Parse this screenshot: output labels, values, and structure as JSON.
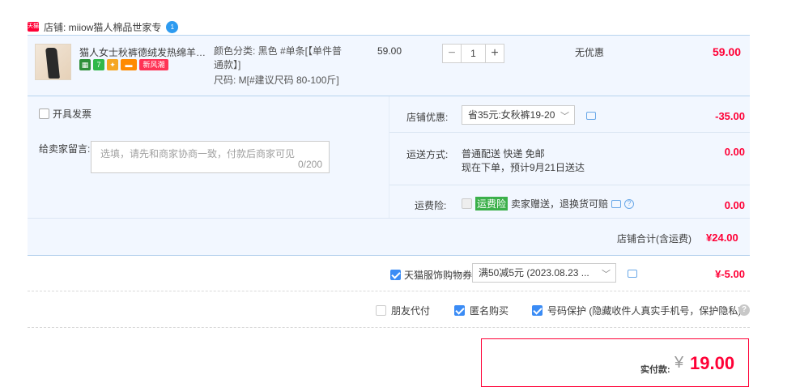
{
  "shop": {
    "logo_text": "天猫",
    "name": "店铺: miiow猫人棉品世家专",
    "ww_badge": "1"
  },
  "item": {
    "title": "猫人女士秋裤德绒发热绵羊毛薄...",
    "badges": [
      "7",
      "新风潮"
    ],
    "attr_color": "颜色分类: 黑色 #单条[【单件普",
    "attr_color2": "通款】]",
    "attr_size": "尺码: M[#建议尺码 80-100斤]",
    "price": "59.00",
    "quantity": "1",
    "minus": "−",
    "plus": "+",
    "discount": "无优惠",
    "subtotal": "59.00"
  },
  "options": {
    "invoice_label": "开具发票",
    "message_label": "给卖家留言:",
    "message_placeholder": "选填，请先和商家协商一致，付款后商家可见",
    "message_count": "0/200",
    "shop_discount_label": "店铺优惠:",
    "shop_discount_value": "省35元:女秋裤19-20",
    "shop_discount_amount": "-35.00",
    "shipping_label": "运送方式:",
    "shipping_line1": "普通配送 快递 免邮",
    "shipping_line2": "现在下单，预计9月21日送达",
    "shipping_amount": "0.00",
    "insurance_label": "运费险:",
    "insurance_tag": "运费险",
    "insurance_text": "卖家赠送，退换货可赔",
    "insurance_amount": "0.00",
    "shop_total_label": "店铺合计(含运费)",
    "shop_total_value": "¥24.00"
  },
  "platform": {
    "coupon_label": "天猫服饰购物券",
    "coupon_value": "满50减5元 (2023.08.23 ...",
    "coupon_amount": "¥-5.00",
    "friend_pay_label": "朋友代付",
    "anonymous_label": "匿名购买",
    "privacy_label": "号码保护 (隐藏收件人真实手机号，保护隐私)"
  },
  "payment": {
    "label": "实付款:",
    "symbol": "¥",
    "value": "19.00"
  },
  "colors": {
    "accent_red": "#ff0036",
    "blue": "#3b8cf5",
    "panel_bg": "#f2f7ff"
  }
}
